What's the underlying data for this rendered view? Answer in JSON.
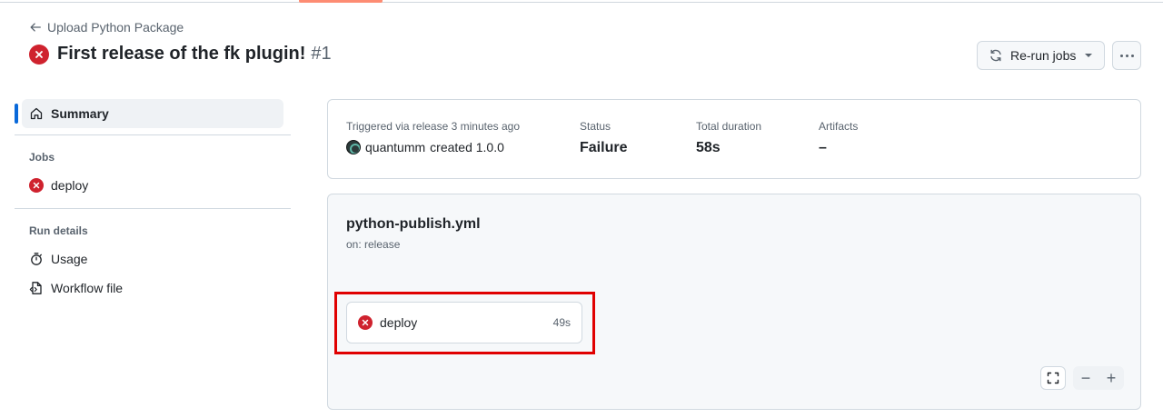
{
  "header": {
    "back_link": "Upload Python Package",
    "title": "First release of the fk plugin!",
    "run_number": "#1",
    "rerun_label": "Re-run jobs"
  },
  "sidebar": {
    "summary_label": "Summary",
    "jobs_heading": "Jobs",
    "jobs": [
      {
        "label": "deploy",
        "status": "failure"
      }
    ],
    "run_details_heading": "Run details",
    "usage_label": "Usage",
    "workflow_file_label": "Workflow file"
  },
  "summary": {
    "trigger_label": "Triggered via release 3 minutes ago",
    "trigger_user": "quantumm",
    "trigger_action": "created 1.0.0",
    "status_label": "Status",
    "status_value": "Failure",
    "duration_label": "Total duration",
    "duration_value": "58s",
    "artifacts_label": "Artifacts",
    "artifacts_value": "–"
  },
  "workflow": {
    "file_name": "python-publish.yml",
    "trigger": "on: release",
    "job": {
      "name": "deploy",
      "duration": "49s",
      "status": "failure"
    }
  },
  "controls": {
    "zoom_out": "−",
    "zoom_in": "+"
  },
  "colors": {
    "failure": "#cf222e",
    "accent": "#0969da",
    "tab_underline": "#fd8c73",
    "highlight_box": "#e00000"
  },
  "icons": {
    "back": "arrow-left-icon",
    "status": "x-circle-icon",
    "rerun": "sync-icon",
    "more": "kebab-horizontal-icon",
    "summary": "home-icon",
    "usage": "stopwatch-icon",
    "workflow_file": "file-code-icon",
    "fullscreen": "screen-full-icon"
  }
}
